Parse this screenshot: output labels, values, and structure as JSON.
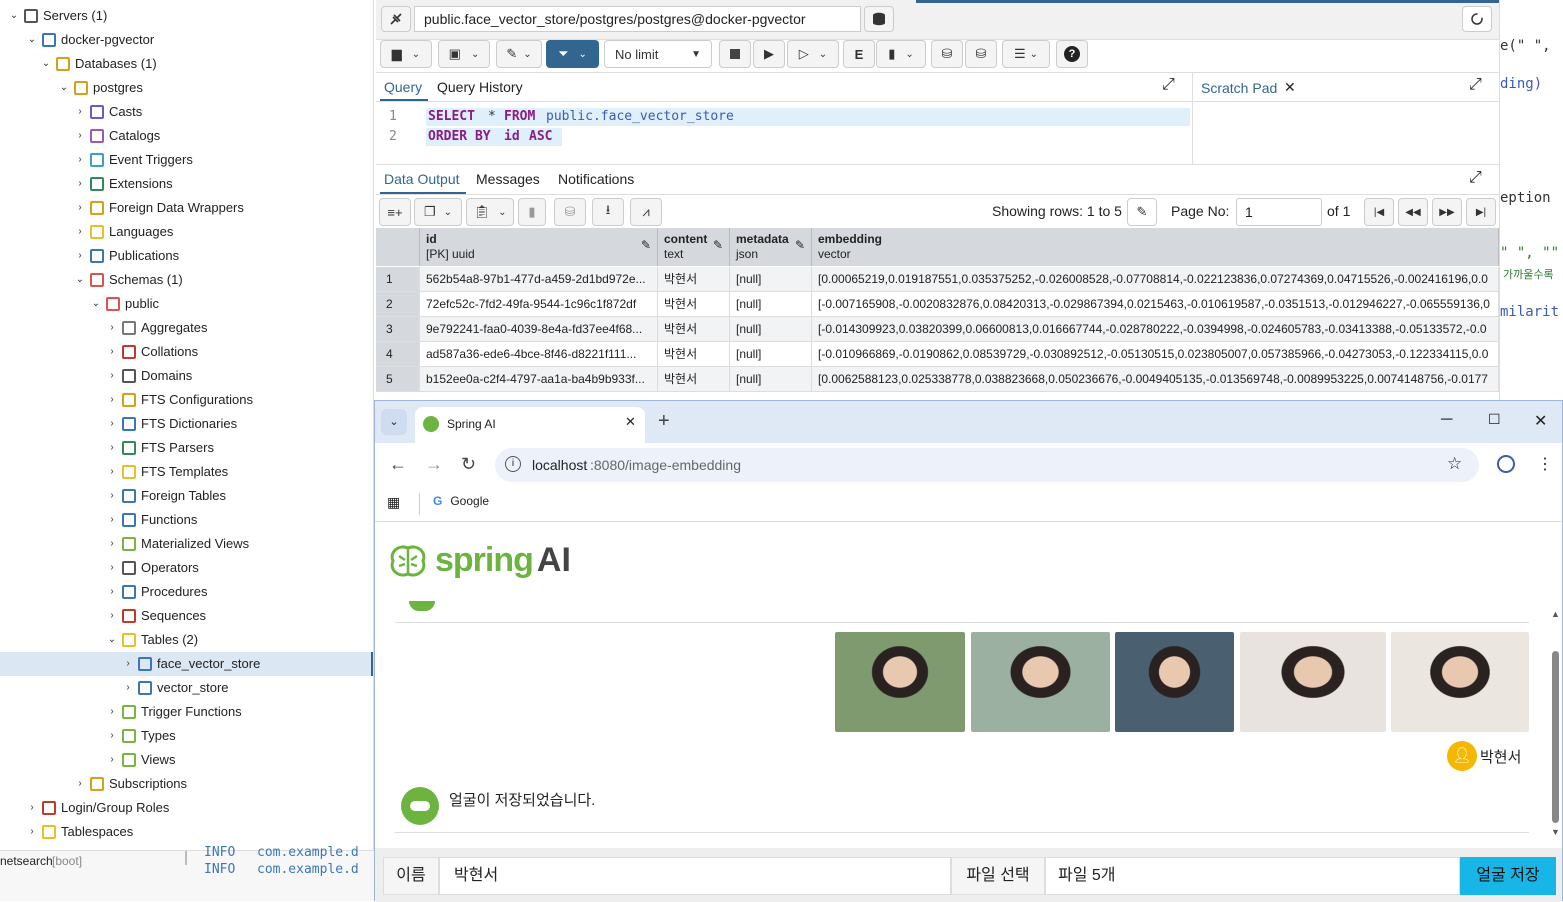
{
  "tree": {
    "items": [
      {
        "label": "Servers (1)",
        "level": 0,
        "chev": "v",
        "icon": "servers-icon",
        "color": "#555"
      },
      {
        "label": "docker-pgvector",
        "level": 1,
        "chev": "v",
        "icon": "elephant-icon",
        "color": "#3b77b8"
      },
      {
        "label": "Databases (1)",
        "level": 2,
        "chev": "v",
        "icon": "database-icon",
        "color": "#d4a017"
      },
      {
        "label": "postgres",
        "level": 3,
        "chev": "v",
        "icon": "database-icon",
        "color": "#d4a017"
      },
      {
        "label": "Casts",
        "level": 4,
        "chev": ">",
        "icon": "cast-icon",
        "color": "#6a5acd"
      },
      {
        "label": "Catalogs",
        "level": 4,
        "chev": ">",
        "icon": "catalog-icon",
        "color": "#9b59b6"
      },
      {
        "label": "Event Triggers",
        "level": 4,
        "chev": ">",
        "icon": "event-trigger-icon",
        "color": "#3aa0c8"
      },
      {
        "label": "Extensions",
        "level": 4,
        "chev": ">",
        "icon": "extension-icon",
        "color": "#2e8b57"
      },
      {
        "label": "Foreign Data Wrappers",
        "level": 4,
        "chev": ">",
        "icon": "fdw-icon",
        "color": "#d4a017"
      },
      {
        "label": "Languages",
        "level": 4,
        "chev": ">",
        "icon": "language-icon",
        "color": "#e6c229"
      },
      {
        "label": "Publications",
        "level": 4,
        "chev": ">",
        "icon": "publication-icon",
        "color": "#3b77b8"
      },
      {
        "label": "Schemas (1)",
        "level": 4,
        "chev": "v",
        "icon": "schema-icon",
        "color": "#d9534f"
      },
      {
        "label": "public",
        "level": 5,
        "chev": "v",
        "icon": "schema-icon",
        "color": "#d9534f"
      },
      {
        "label": "Aggregates",
        "level": 6,
        "chev": ">",
        "icon": "aggregate-icon",
        "color": "#777"
      },
      {
        "label": "Collations",
        "level": 6,
        "chev": ">",
        "icon": "collation-icon",
        "color": "#c0392b"
      },
      {
        "label": "Domains",
        "level": 6,
        "chev": ">",
        "icon": "domain-icon",
        "color": "#555"
      },
      {
        "label": "FTS Configurations",
        "level": 6,
        "chev": ">",
        "icon": "fts-config-icon",
        "color": "#d4a017"
      },
      {
        "label": "FTS Dictionaries",
        "level": 6,
        "chev": ">",
        "icon": "fts-dictionary-icon",
        "color": "#3b77b8"
      },
      {
        "label": "FTS Parsers",
        "level": 6,
        "chev": ">",
        "icon": "fts-parser-icon",
        "color": "#2e8b57"
      },
      {
        "label": "FTS Templates",
        "level": 6,
        "chev": ">",
        "icon": "fts-template-icon",
        "color": "#e6c229"
      },
      {
        "label": "Foreign Tables",
        "level": 6,
        "chev": ">",
        "icon": "foreign-table-icon",
        "color": "#3b77b8"
      },
      {
        "label": "Functions",
        "level": 6,
        "chev": ">",
        "icon": "function-icon",
        "color": "#3b77b8"
      },
      {
        "label": "Materialized Views",
        "level": 6,
        "chev": ">",
        "icon": "materialized-view-icon",
        "color": "#7cb342"
      },
      {
        "label": "Operators",
        "level": 6,
        "chev": ">",
        "icon": "operator-icon",
        "color": "#555"
      },
      {
        "label": "Procedures",
        "level": 6,
        "chev": ">",
        "icon": "procedure-icon",
        "color": "#3b77b8"
      },
      {
        "label": "Sequences",
        "level": 6,
        "chev": ">",
        "icon": "sequence-icon",
        "color": "#c0392b"
      },
      {
        "label": "Tables (2)",
        "level": 6,
        "chev": "v",
        "icon": "table-icon",
        "color": "#e6c229"
      },
      {
        "label": "face_vector_store",
        "level": 7,
        "chev": ">",
        "icon": "table-icon",
        "color": "#3b77b8",
        "selected": true
      },
      {
        "label": "vector_store",
        "level": 7,
        "chev": ">",
        "icon": "table-icon",
        "color": "#3b77b8"
      },
      {
        "label": "Trigger Functions",
        "level": 6,
        "chev": ">",
        "icon": "trigger-function-icon",
        "color": "#7cb342"
      },
      {
        "label": "Types",
        "level": 6,
        "chev": ">",
        "icon": "type-icon",
        "color": "#7cb342"
      },
      {
        "label": "Views",
        "level": 6,
        "chev": ">",
        "icon": "view-icon",
        "color": "#7cb342"
      },
      {
        "label": "Subscriptions",
        "level": 4,
        "chev": ">",
        "icon": "subscription-icon",
        "color": "#d4a017"
      },
      {
        "label": "Login/Group Roles",
        "level": 1,
        "chev": ">",
        "icon": "roles-icon",
        "color": "#c0392b"
      },
      {
        "label": "Tablespaces",
        "level": 1,
        "chev": ">",
        "icon": "tablespace-icon",
        "color": "#e6c229"
      }
    ]
  },
  "console": {
    "left_label": "netsearch",
    "boot": "[boot]",
    "lines": [
      {
        "level": "INFO",
        "text": "com.example.d"
      },
      {
        "level": "INFO",
        "text": "com.example.d"
      }
    ]
  },
  "right_editor": {
    "lines": [
      "e(\" \",",
      "ding)",
      "eption",
      "\" \", \"\"",
      "가까울수록",
      "milarit"
    ]
  },
  "pgadmin": {
    "connection": "public.face_vector_store/postgres/postgres@docker-pgvector",
    "limit": "No limit",
    "query_tabs": [
      "Query",
      "Query History"
    ],
    "scratch": "Scratch Pad",
    "sql": [
      {
        "num": "1",
        "k1": "SELECT",
        "op": "*",
        "k2": "FROM",
        "ident": "public.face_vector_store"
      },
      {
        "num": "2",
        "k1": "ORDER BY",
        "ident": "id",
        "k2": "ASC"
      }
    ],
    "output_tabs": [
      "Data Output",
      "Messages",
      "Notifications"
    ],
    "showing": "Showing rows: 1 to 5",
    "page_no_label": "Page No:",
    "page_no": "1",
    "of": "of 1",
    "columns": [
      {
        "name": "id",
        "type": "[PK] uuid"
      },
      {
        "name": "content",
        "type": "text"
      },
      {
        "name": "metadata",
        "type": "json"
      },
      {
        "name": "embedding",
        "type": "vector"
      }
    ],
    "rows": [
      {
        "n": "1",
        "id": "562b54a8-97b1-477d-a459-2d1bd972e...",
        "content": "박현서",
        "metadata": "[null]",
        "embedding": "[0.00065219,0.019187551,0.035375252,-0.026008528,-0.07708814,-0.022123836,0.07274369,0.04715526,-0.002416196,0.0"
      },
      {
        "n": "2",
        "id": "72efc52c-7fd2-49fa-9544-1c96c1f872df",
        "content": "박현서",
        "metadata": "[null]",
        "embedding": "[-0.007165908,-0.0020832876,0.08420313,-0.029867394,0.0215463,-0.010619587,-0.0351513,-0.012946227,-0.065559136,0"
      },
      {
        "n": "3",
        "id": "9e792241-faa0-4039-8e4a-fd37ee4f68...",
        "content": "박현서",
        "metadata": "[null]",
        "embedding": "[-0.014309923,0.03820399,0.06600813,0.016667744,-0.028780222,-0.0394998,-0.024605783,-0.03413388,-0.05133572,-0.0"
      },
      {
        "n": "4",
        "id": "ad587a36-ede6-4bce-8f46-d8221f111...",
        "content": "박현서",
        "metadata": "[null]",
        "embedding": "[-0.010966869,-0.0190862,0.08539729,-0.030892512,-0.05130515,0.023805007,0.057385966,-0.04273053,-0.122334115,0.0"
      },
      {
        "n": "5",
        "id": "b152ee0a-c2f4-4797-aa1a-ba4b9b933f...",
        "content": "박현서",
        "metadata": "[null]",
        "embedding": "[0.0062588123,0.025338778,0.038823668,0.050236676,-0.0049405135,-0.013569748,-0.0089953225,0.0074148756,-0.0177"
      }
    ]
  },
  "browser": {
    "tab_title": "Spring AI",
    "url_host": "localhost",
    "url_rest": ":8080/image-embedding",
    "bookmark": "Google",
    "logo_word": "spring",
    "logo_ai": "AI",
    "user_name": "박현서",
    "bot_message": "얼굴이 저장되었습니다.",
    "name_label": "이름",
    "name_value": "박현서",
    "file_label": "파일 선택",
    "file_value": "파일 5개",
    "save_button": "얼굴 저장",
    "photos": [
      {
        "bg": "#7f9a6e"
      },
      {
        "bg": "#9bb0a0"
      },
      {
        "bg": "#4a6070"
      },
      {
        "bg": "#e8e3de"
      },
      {
        "bg": "#ece6e1"
      }
    ]
  }
}
